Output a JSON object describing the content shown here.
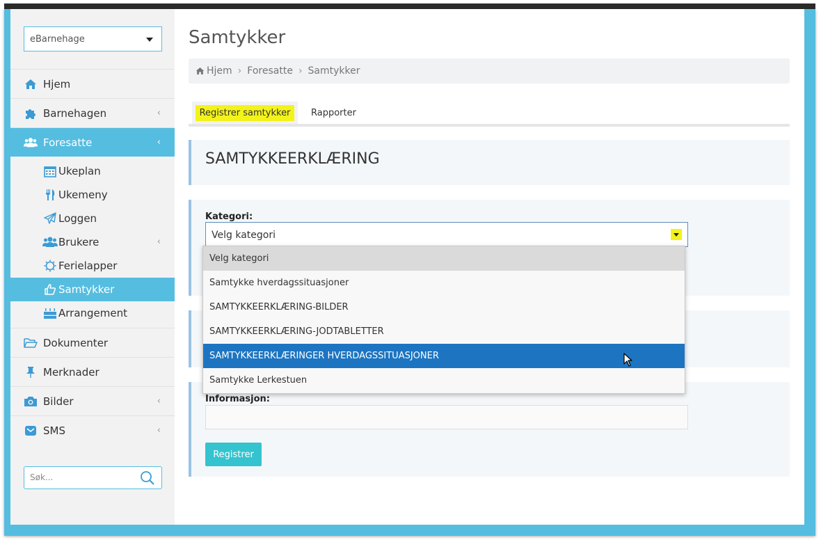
{
  "sidebar": {
    "select_value": "eBarnehage",
    "items": [
      {
        "label": "Hjem",
        "icon": "home-icon"
      },
      {
        "label": "Barnehagen",
        "icon": "puzzle-icon"
      },
      {
        "label": "Foresatte",
        "icon": "users-icon"
      }
    ],
    "subitems": [
      {
        "label": "Ukeplan",
        "icon": "calendar-icon"
      },
      {
        "label": "Ukemeny",
        "icon": "cutlery-icon"
      },
      {
        "label": "Loggen",
        "icon": "paper-plane-icon"
      },
      {
        "label": "Brukere",
        "icon": "users-icon"
      },
      {
        "label": "Ferielapper",
        "icon": "sun-icon"
      },
      {
        "label": "Samtykker",
        "icon": "thumbs-up-icon"
      },
      {
        "label": "Arrangement",
        "icon": "cake-icon"
      }
    ],
    "items_after": [
      {
        "label": "Dokumenter",
        "icon": "folder-icon"
      },
      {
        "label": "Merknader",
        "icon": "pin-icon"
      },
      {
        "label": "Bilder",
        "icon": "camera-icon"
      },
      {
        "label": "SMS",
        "icon": "envelope-icon"
      }
    ],
    "search_placeholder": "Søk..."
  },
  "page": {
    "title": "Samtykker",
    "breadcrumb": [
      "Hjem",
      "Foresatte",
      "Samtykker"
    ]
  },
  "tabs": [
    "Registrer samtykker",
    "Rapporter"
  ],
  "card_title": "SAMTYKKEERKLÆRING",
  "form": {
    "category_label": "Kategori:",
    "category_value": "Velg kategori",
    "info_label": "Informasjon:",
    "submit_label": "Registrer"
  },
  "dropdown": {
    "options": [
      "Velg kategori",
      "Samtykke hverdagssituasjoner",
      "SAMTYKKEERKLÆRING-BILDER",
      "SAMTYKKEERKLÆRING-JODTABLETTER",
      "SAMTYKKEERKLÆRINGER HVERDAGSSITUASJONER",
      "Samtykke Lerkestuen"
    ],
    "selected_index": 0,
    "hover_index": 4
  },
  "colors": {
    "accent": "#55bde0",
    "highlight": "#f3f31b",
    "hover": "#1d75c2",
    "button": "#34c3cf"
  }
}
